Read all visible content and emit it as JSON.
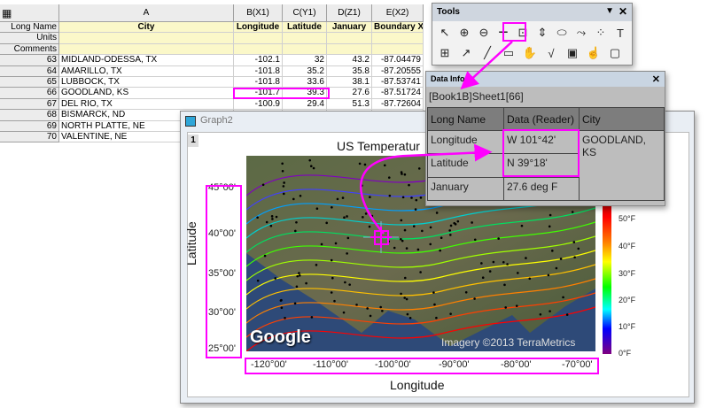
{
  "sheet": {
    "corner_icon": "worksheet-icon",
    "columns": [
      "A",
      "B(X1)",
      "C(Y1)",
      "D(Z1)",
      "E(X2)"
    ],
    "meta_labels": [
      "Long Name",
      "Units",
      "Comments"
    ],
    "long_names": [
      "City",
      "Longitude",
      "Latitude",
      "January",
      "Boundary X"
    ],
    "rows": [
      {
        "n": "63",
        "city": "MIDLAND-ODESSA, TX",
        "lon": "-102.1",
        "lat": "32",
        "jan": "43.2",
        "bx": "-87.04479"
      },
      {
        "n": "64",
        "city": "AMARILLO, TX",
        "lon": "-101.8",
        "lat": "35.2",
        "jan": "35.8",
        "bx": "-87.20555"
      },
      {
        "n": "65",
        "city": "LUBBOCK, TX",
        "lon": "-101.8",
        "lat": "33.6",
        "jan": "38.1",
        "bx": "-87.53741"
      },
      {
        "n": "66",
        "city": "GOODLAND, KS",
        "lon": "-101.7",
        "lat": "39.3",
        "jan": "27.6",
        "bx": "-87.51724"
      },
      {
        "n": "67",
        "city": "DEL RIO, TX",
        "lon": "-100.9",
        "lat": "29.4",
        "jan": "51.3",
        "bx": "-87.72604"
      },
      {
        "n": "68",
        "city": "BISMARCK, ND"
      },
      {
        "n": "69",
        "city": "NORTH PLATTE, NE"
      },
      {
        "n": "70",
        "city": "VALENTINE, NE"
      }
    ]
  },
  "tools": {
    "title": "Tools",
    "row1": [
      "pointer",
      "zoom-in",
      "zoom-out",
      "screen-reader",
      "data-reader",
      "data-selector",
      "region-mask",
      "region-draw",
      "annotation",
      "text"
    ],
    "row2": [
      "region-of-interest",
      "arrow",
      "line",
      "rectangle",
      "pan",
      "insert-equation",
      "insert-graph",
      "move-data",
      "3d-rotate"
    ]
  },
  "data_info": {
    "title": "Data Info",
    "source": "[Book1B]Sheet1[66]",
    "headers": [
      "Long Name",
      "Data (Reader)",
      "City"
    ],
    "rows": [
      {
        "name": "Longitude",
        "value": "W 101°42'"
      },
      {
        "name": "Latitude",
        "value": "N 39°18'"
      },
      {
        "name": "January",
        "value": "27.6 deg F"
      }
    ],
    "city": "GOODLAND, KS"
  },
  "graph": {
    "window_title": "Graph2",
    "layer": "1",
    "title": "US Temperatur",
    "xlabel": "Longitude",
    "ylabel": "Latitude",
    "xticks": [
      "-120°00'",
      "-110°00'",
      "-100°00'",
      "-90°00'",
      "-80°00'",
      "-70°00'"
    ],
    "yticks": [
      "45°00'",
      "40°00'",
      "35°00'",
      "30°00'",
      "25°00'"
    ],
    "colorbar": [
      "50°F",
      "40°F",
      "30°F",
      "20°F",
      "10°F",
      "0°F"
    ],
    "watermark": "Google",
    "credit": "Imagery ©2013 TerraMetrics",
    "highlight_color": "#ff00ff"
  }
}
